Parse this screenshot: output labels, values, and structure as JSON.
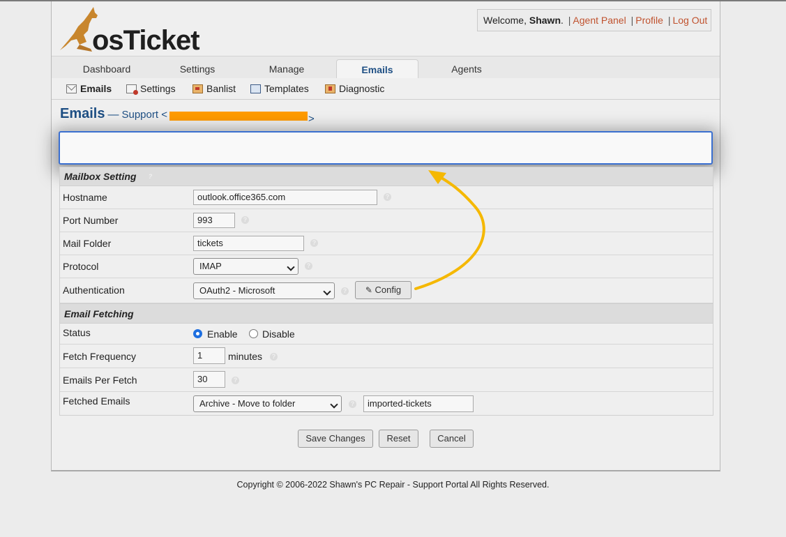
{
  "brand": {
    "logo_text": "osTicket"
  },
  "userbar": {
    "welcome": "Welcome, ",
    "user": "Shawn",
    "dot": ".",
    "sep": "|",
    "agent_panel": "Agent Panel",
    "profile": "Profile",
    "logout": "Log Out"
  },
  "nav": {
    "tabs": [
      "Dashboard",
      "Settings",
      "Manage",
      "Emails",
      "Agents"
    ]
  },
  "subnav": {
    "items": [
      "Emails",
      "Settings",
      "Banlist",
      "Templates",
      "Diagnostic"
    ]
  },
  "page": {
    "title": "Emails",
    "dash": "—",
    "subtitle": "Support <",
    "subtitle_end": ">"
  },
  "mailbox": {
    "section": "Mailbox Setting",
    "hostname_label": "Hostname",
    "hostname": "outlook.office365.com",
    "port_label": "Port Number",
    "port": "993",
    "folder_label": "Mail Folder",
    "folder": "tickets",
    "protocol_label": "Protocol",
    "protocol": "IMAP",
    "auth_label": "Authentication",
    "auth": "OAuth2 - Microsoft",
    "config_button": "Config"
  },
  "fetching": {
    "section": "Email Fetching",
    "status_label": "Status",
    "enable": "Enable",
    "disable": "Disable",
    "frequency_label": "Fetch Frequency",
    "frequency": "1",
    "frequency_unit": "minutes",
    "per_fetch_label": "Emails Per Fetch",
    "per_fetch": "30",
    "fetched_label": "Fetched Emails",
    "fetched_action": "Archive - Move to folder",
    "archive_folder": "imported-tickets"
  },
  "actions": {
    "save": "Save Changes",
    "reset": "Reset",
    "cancel": "Cancel"
  },
  "footer": {
    "copyright": "Copyright © 2006-2022 Shawn's PC Repair - Support Portal All Rights Reserved."
  },
  "colors": {
    "link": "#c0522e",
    "accent": "#1e4f84",
    "highlight_border": "#3a6fd0",
    "arrow": "#f5b800",
    "redaction": "#ff9b00"
  }
}
